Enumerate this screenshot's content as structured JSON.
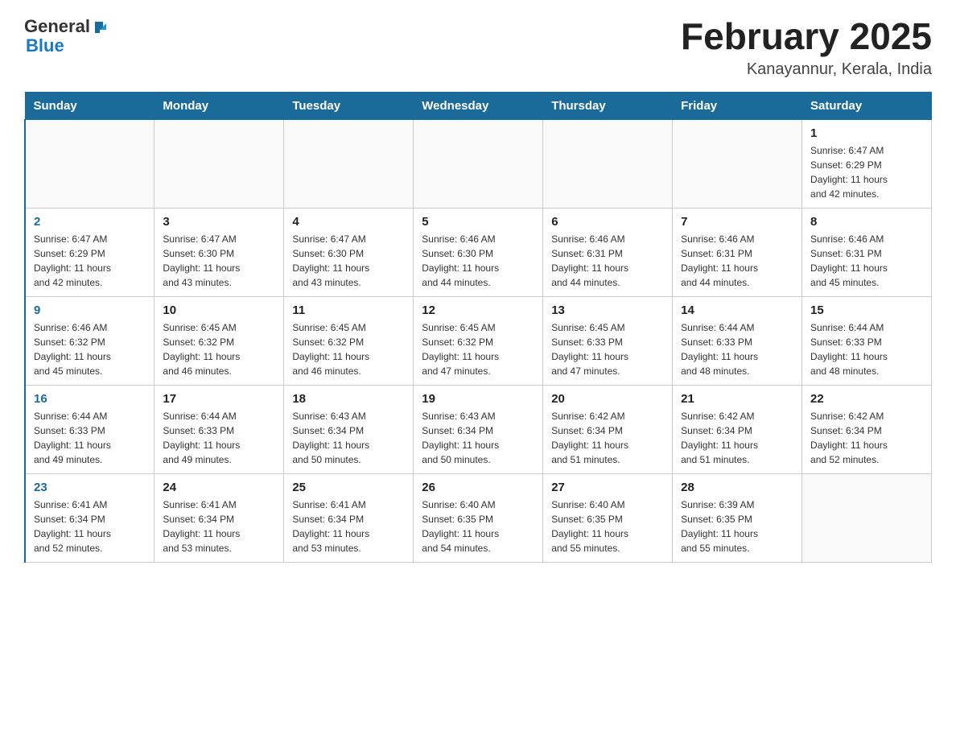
{
  "header": {
    "logo_general": "General",
    "logo_blue": "Blue",
    "month_title": "February 2025",
    "location": "Kanayannur, Kerala, India"
  },
  "weekdays": [
    "Sunday",
    "Monday",
    "Tuesday",
    "Wednesday",
    "Thursday",
    "Friday",
    "Saturday"
  ],
  "weeks": [
    [
      {
        "day": "",
        "info": ""
      },
      {
        "day": "",
        "info": ""
      },
      {
        "day": "",
        "info": ""
      },
      {
        "day": "",
        "info": ""
      },
      {
        "day": "",
        "info": ""
      },
      {
        "day": "",
        "info": ""
      },
      {
        "day": "1",
        "info": "Sunrise: 6:47 AM\nSunset: 6:29 PM\nDaylight: 11 hours\nand 42 minutes."
      }
    ],
    [
      {
        "day": "2",
        "info": "Sunrise: 6:47 AM\nSunset: 6:29 PM\nDaylight: 11 hours\nand 42 minutes."
      },
      {
        "day": "3",
        "info": "Sunrise: 6:47 AM\nSunset: 6:30 PM\nDaylight: 11 hours\nand 43 minutes."
      },
      {
        "day": "4",
        "info": "Sunrise: 6:47 AM\nSunset: 6:30 PM\nDaylight: 11 hours\nand 43 minutes."
      },
      {
        "day": "5",
        "info": "Sunrise: 6:46 AM\nSunset: 6:30 PM\nDaylight: 11 hours\nand 44 minutes."
      },
      {
        "day": "6",
        "info": "Sunrise: 6:46 AM\nSunset: 6:31 PM\nDaylight: 11 hours\nand 44 minutes."
      },
      {
        "day": "7",
        "info": "Sunrise: 6:46 AM\nSunset: 6:31 PM\nDaylight: 11 hours\nand 44 minutes."
      },
      {
        "day": "8",
        "info": "Sunrise: 6:46 AM\nSunset: 6:31 PM\nDaylight: 11 hours\nand 45 minutes."
      }
    ],
    [
      {
        "day": "9",
        "info": "Sunrise: 6:46 AM\nSunset: 6:32 PM\nDaylight: 11 hours\nand 45 minutes."
      },
      {
        "day": "10",
        "info": "Sunrise: 6:45 AM\nSunset: 6:32 PM\nDaylight: 11 hours\nand 46 minutes."
      },
      {
        "day": "11",
        "info": "Sunrise: 6:45 AM\nSunset: 6:32 PM\nDaylight: 11 hours\nand 46 minutes."
      },
      {
        "day": "12",
        "info": "Sunrise: 6:45 AM\nSunset: 6:32 PM\nDaylight: 11 hours\nand 47 minutes."
      },
      {
        "day": "13",
        "info": "Sunrise: 6:45 AM\nSunset: 6:33 PM\nDaylight: 11 hours\nand 47 minutes."
      },
      {
        "day": "14",
        "info": "Sunrise: 6:44 AM\nSunset: 6:33 PM\nDaylight: 11 hours\nand 48 minutes."
      },
      {
        "day": "15",
        "info": "Sunrise: 6:44 AM\nSunset: 6:33 PM\nDaylight: 11 hours\nand 48 minutes."
      }
    ],
    [
      {
        "day": "16",
        "info": "Sunrise: 6:44 AM\nSunset: 6:33 PM\nDaylight: 11 hours\nand 49 minutes."
      },
      {
        "day": "17",
        "info": "Sunrise: 6:44 AM\nSunset: 6:33 PM\nDaylight: 11 hours\nand 49 minutes."
      },
      {
        "day": "18",
        "info": "Sunrise: 6:43 AM\nSunset: 6:34 PM\nDaylight: 11 hours\nand 50 minutes."
      },
      {
        "day": "19",
        "info": "Sunrise: 6:43 AM\nSunset: 6:34 PM\nDaylight: 11 hours\nand 50 minutes."
      },
      {
        "day": "20",
        "info": "Sunrise: 6:42 AM\nSunset: 6:34 PM\nDaylight: 11 hours\nand 51 minutes."
      },
      {
        "day": "21",
        "info": "Sunrise: 6:42 AM\nSunset: 6:34 PM\nDaylight: 11 hours\nand 51 minutes."
      },
      {
        "day": "22",
        "info": "Sunrise: 6:42 AM\nSunset: 6:34 PM\nDaylight: 11 hours\nand 52 minutes."
      }
    ],
    [
      {
        "day": "23",
        "info": "Sunrise: 6:41 AM\nSunset: 6:34 PM\nDaylight: 11 hours\nand 52 minutes."
      },
      {
        "day": "24",
        "info": "Sunrise: 6:41 AM\nSunset: 6:34 PM\nDaylight: 11 hours\nand 53 minutes."
      },
      {
        "day": "25",
        "info": "Sunrise: 6:41 AM\nSunset: 6:34 PM\nDaylight: 11 hours\nand 53 minutes."
      },
      {
        "day": "26",
        "info": "Sunrise: 6:40 AM\nSunset: 6:35 PM\nDaylight: 11 hours\nand 54 minutes."
      },
      {
        "day": "27",
        "info": "Sunrise: 6:40 AM\nSunset: 6:35 PM\nDaylight: 11 hours\nand 55 minutes."
      },
      {
        "day": "28",
        "info": "Sunrise: 6:39 AM\nSunset: 6:35 PM\nDaylight: 11 hours\nand 55 minutes."
      },
      {
        "day": "",
        "info": ""
      }
    ]
  ]
}
